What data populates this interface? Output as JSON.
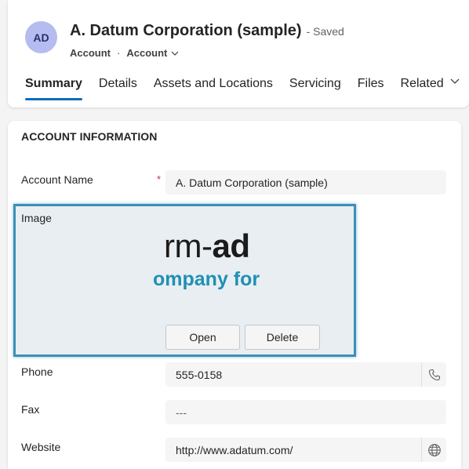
{
  "header": {
    "avatar_initials": "AD",
    "title": "A. Datum Corporation (sample)",
    "save_status": "- Saved",
    "entity_type": "Account",
    "separator": "·",
    "form_selector": "Account"
  },
  "tabs": [
    {
      "label": "Summary",
      "active": true
    },
    {
      "label": "Details"
    },
    {
      "label": "Assets and Locations"
    },
    {
      "label": "Servicing"
    },
    {
      "label": "Files"
    },
    {
      "label": "Related"
    }
  ],
  "section": {
    "title": "ACCOUNT INFORMATION",
    "account_name": {
      "label": "Account Name",
      "required_marker": "*",
      "value": "A. Datum Corporation (sample)"
    },
    "image": {
      "label": "Image",
      "logo_line1_prefix": "rm-",
      "logo_line1_bold": "ad",
      "logo_line2": "ompany for",
      "open_label": "Open",
      "delete_label": "Delete"
    },
    "phone": {
      "label": "Phone",
      "value": "555-0158",
      "action_icon": "phone-icon"
    },
    "fax": {
      "label": "Fax",
      "value": "---"
    },
    "website": {
      "label": "Website",
      "value": "http://www.adatum.com/",
      "action_icon": "globe-icon"
    }
  },
  "colors": {
    "accent": "#0f6cbd",
    "avatar_bg": "#b4bcf0",
    "focus_border": "#3d8fb8",
    "required": "#c4314b",
    "logo_teal": "#1f90b4"
  }
}
